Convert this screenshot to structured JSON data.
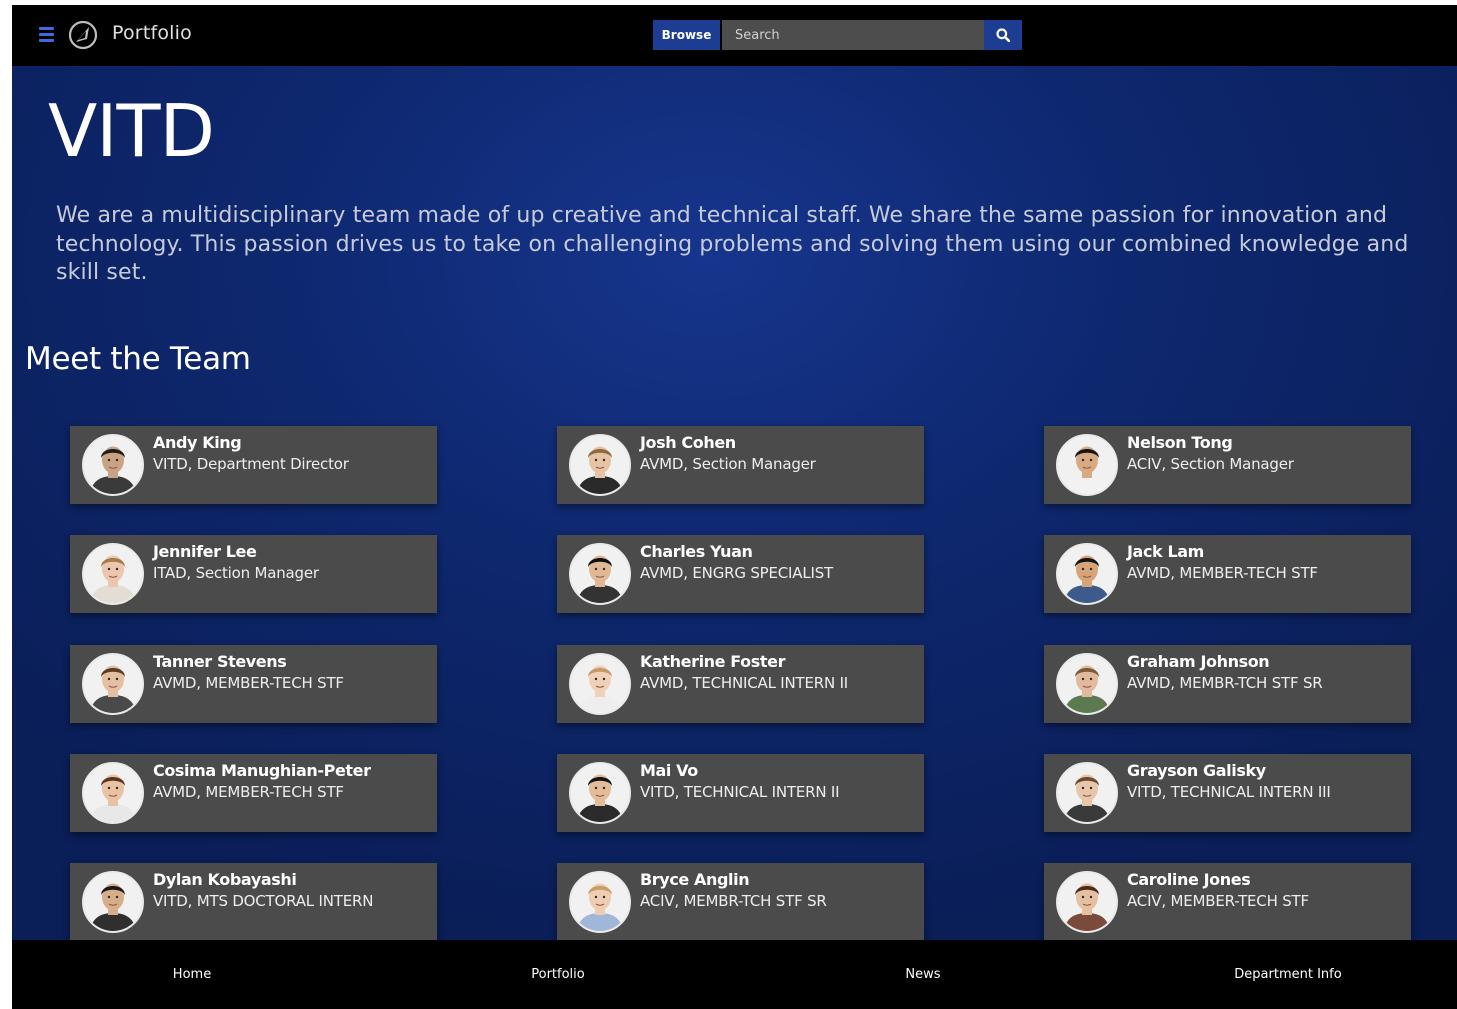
{
  "header": {
    "title": "Portfolio",
    "browse_label": "Browse",
    "search_placeholder": "Search"
  },
  "hero": {
    "title": "VITD",
    "description": "We are a multidisciplinary team made of up creative and technical staff. We share the same passion for innovation and technology. This passion drives us to take on challenging problems and solving them using our combined knowledge and skill set."
  },
  "team": {
    "heading": "Meet the Team",
    "members": [
      {
        "name": "Andy King",
        "role": "VITD, Department Director",
        "skin": "#c9a283",
        "hair": "#1e1e1e",
        "shirt": "#3a3a3a"
      },
      {
        "name": "Josh Cohen",
        "role": "AVMD, Section Manager",
        "skin": "#e7c3a6",
        "hair": "#8a6a3e",
        "shirt": "#2a2a2a"
      },
      {
        "name": "Nelson Tong",
        "role": "ACIV, Section Manager",
        "skin": "#d9aa82",
        "hair": "#151515",
        "shirt": "#f2f2f2"
      },
      {
        "name": "Jennifer Lee",
        "role": "ITAD, Section Manager",
        "skin": "#ecc7ad",
        "hair": "#a6784a",
        "shirt": "#e3ddd3"
      },
      {
        "name": "Charles Yuan",
        "role": "AVMD, ENGRG SPECIALIST",
        "skin": "#e1b894",
        "hair": "#111111",
        "shirt": "#333333"
      },
      {
        "name": "Jack Lam",
        "role": "AVMD, MEMBER-TECH STF",
        "skin": "#d6a478",
        "hair": "#141414",
        "shirt": "#3c5a8a"
      },
      {
        "name": "Tanner Stevens",
        "role": "AVMD, MEMBER-TECH STF",
        "skin": "#e5bfa2",
        "hair": "#5a3d24",
        "shirt": "#4a4a4a"
      },
      {
        "name": "Katherine Foster",
        "role": "AVMD, TECHNICAL INTERN II",
        "skin": "#f0d0b8",
        "hair": "#c79a68",
        "shirt": "#eeeeee"
      },
      {
        "name": "Graham Johnson",
        "role": "AVMD, MEMBR-TCH STF SR",
        "skin": "#e2b99c",
        "hair": "#7a5a3c",
        "shirt": "#5b7a50"
      },
      {
        "name": "Cosima Manughian-Peter",
        "role": "AVMD, MEMBER-TECH STF",
        "skin": "#e9c1a3",
        "hair": "#5a3620",
        "shirt": "#e8e8e8"
      },
      {
        "name": "Mai Vo",
        "role": "VITD, TECHNICAL INTERN II",
        "skin": "#e4bc98",
        "hair": "#141414",
        "shirt": "#2b2b2b"
      },
      {
        "name": "Grayson Galisky",
        "role": "VITD, TECHNICAL INTERN III",
        "skin": "#e8c6aa",
        "hair": "#6b4c31",
        "shirt": "#3a3a3a"
      },
      {
        "name": "Dylan Kobayashi",
        "role": "VITD, MTS DOCTORAL INTERN",
        "skin": "#d8ad8a",
        "hair": "#1a1a1a",
        "shirt": "#2f2f2f"
      },
      {
        "name": "Bryce Anglin",
        "role": "ACIV, MEMBR-TCH STF SR",
        "skin": "#efcdb2",
        "hair": "#c4a066",
        "shirt": "#9fb7d8"
      },
      {
        "name": "Caroline Jones",
        "role": "ACIV, MEMBER-TECH STF",
        "skin": "#e6bea0",
        "hair": "#4a2c1a",
        "shirt": "#7a4a3a"
      }
    ]
  },
  "footer": {
    "links": [
      "Home",
      "Portfolio",
      "News",
      "Department Info"
    ]
  },
  "colors": {
    "accent": "#1d3d92",
    "background": "#0e286f",
    "card": "#4b4b4b",
    "bar": "#000000"
  }
}
